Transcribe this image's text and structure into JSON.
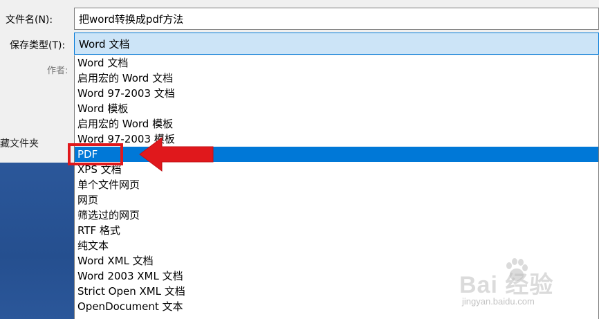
{
  "form": {
    "filename_label": "文件名(N):",
    "filename_value": "把word转换成pdf方法",
    "type_label": "保存类型(T):",
    "type_value": "Word 文档",
    "author_label": "作者:",
    "favorites_label": "藏文件夹"
  },
  "dropdown": {
    "items": [
      {
        "label": "Word 文档"
      },
      {
        "label": "启用宏的 Word 文档"
      },
      {
        "label": "Word 97-2003 文档"
      },
      {
        "label": "Word 模板"
      },
      {
        "label": "启用宏的 Word 模板"
      },
      {
        "label": "Word 97-2003 模板"
      },
      {
        "label": "PDF"
      },
      {
        "label": "XPS 文档"
      },
      {
        "label": "单个文件网页"
      },
      {
        "label": "网页"
      },
      {
        "label": "筛选过的网页"
      },
      {
        "label": "RTF 格式"
      },
      {
        "label": "纯文本"
      },
      {
        "label": "Word XML 文档"
      },
      {
        "label": "Word 2003 XML 文档"
      },
      {
        "label": "Strict Open XML 文档"
      },
      {
        "label": "OpenDocument 文本"
      }
    ],
    "selected_index": 6
  },
  "annotation": {
    "icon": "red-arrow-icon",
    "color": "#e0181c"
  },
  "watermark": {
    "brand": "Bai  经验",
    "url": "jingyan.baidu.com"
  },
  "colors": {
    "selection": "#0078d7",
    "type_field_bg": "#cce4f7",
    "backstage_blue": "#2b579a"
  }
}
